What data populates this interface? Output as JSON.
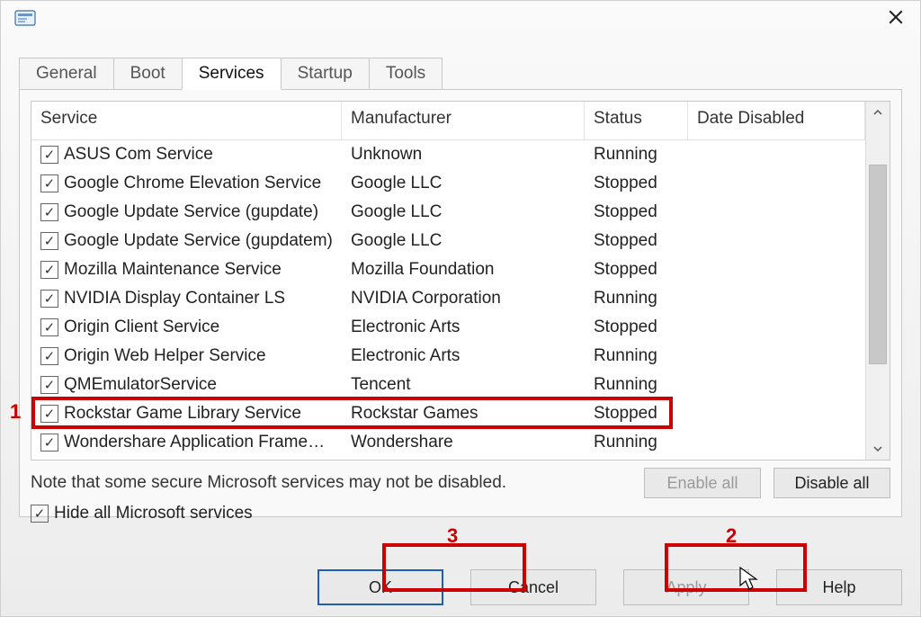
{
  "tabs": {
    "general": "General",
    "boot": "Boot",
    "services": "Services",
    "startup": "Startup",
    "tools": "Tools"
  },
  "columns": {
    "service": "Service",
    "manufacturer": "Manufacturer",
    "status": "Status",
    "date_disabled": "Date Disabled"
  },
  "rows": [
    {
      "service": "ASUS Com Service",
      "manufacturer": "Unknown",
      "status": "Running",
      "date": ""
    },
    {
      "service": "Google Chrome Elevation Service",
      "manufacturer": "Google LLC",
      "status": "Stopped",
      "date": ""
    },
    {
      "service": "Google Update Service (gupdate)",
      "manufacturer": "Google LLC",
      "status": "Stopped",
      "date": ""
    },
    {
      "service": "Google Update Service (gupdatem)",
      "manufacturer": "Google LLC",
      "status": "Stopped",
      "date": ""
    },
    {
      "service": "Mozilla Maintenance Service",
      "manufacturer": "Mozilla Foundation",
      "status": "Stopped",
      "date": ""
    },
    {
      "service": "NVIDIA Display Container LS",
      "manufacturer": "NVIDIA Corporation",
      "status": "Running",
      "date": ""
    },
    {
      "service": "Origin Client Service",
      "manufacturer": "Electronic Arts",
      "status": "Stopped",
      "date": ""
    },
    {
      "service": "Origin Web Helper Service",
      "manufacturer": "Electronic Arts",
      "status": "Running",
      "date": ""
    },
    {
      "service": "QMEmulatorService",
      "manufacturer": "Tencent",
      "status": "Running",
      "date": ""
    },
    {
      "service": "Rockstar Game Library Service",
      "manufacturer": "Rockstar Games",
      "status": "Stopped",
      "date": ""
    },
    {
      "service": "Wondershare Application Frame…",
      "manufacturer": "Wondershare",
      "status": "Running",
      "date": ""
    }
  ],
  "note": "Note that some secure Microsoft services may not be disabled.",
  "hide_ms": "Hide all Microsoft services",
  "buttons": {
    "enable_all": "Enable all",
    "disable_all": "Disable all",
    "ok": "OK",
    "cancel": "Cancel",
    "apply": "Apply",
    "help": "Help"
  },
  "annotations": {
    "n1": "1",
    "n2": "2",
    "n3": "3"
  }
}
